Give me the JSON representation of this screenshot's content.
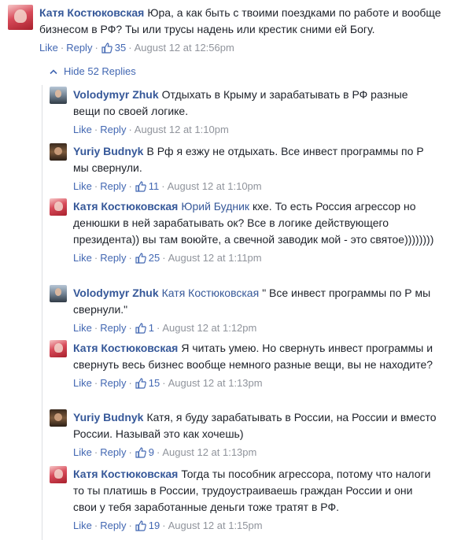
{
  "comments": [
    {
      "author": "Катя Костюковская",
      "mention": "",
      "text": "Юра, а как быть с твоими поездками по работе и вообще бизнесом в РФ? Ты или трусы надень или крестик сними ей Богу.",
      "like_label": "Like",
      "reply_label": "Reply",
      "likes": "35",
      "time": "August 12 at 12:56pm",
      "avatar": "katya"
    }
  ],
  "hide_replies_label": "Hide 52 Replies",
  "replies": [
    {
      "author": "Volodymyr Zhuk",
      "mention": "",
      "text": "Отдыхать в Крыму и зарабатывать в РФ разные вещи по своей логике.",
      "like_label": "Like",
      "reply_label": "Reply",
      "likes": "",
      "time": "August 12 at 1:10pm",
      "avatar": "volodymyr"
    },
    {
      "author": "Yuriy Budnyk",
      "mention": "",
      "text": "В Рф я езжу не отдыхать. Все инвест программы по Р мы свернули.",
      "like_label": "Like",
      "reply_label": "Reply",
      "likes": "11",
      "time": "August 12 at 1:10pm",
      "avatar": "yuriy"
    },
    {
      "author": "Катя Костюковская",
      "mention": "Юрий Будник",
      "text": "кхе. То есть Россия агрессор но денюшки в ней зарабатывать ок? Все в логике действующего президента)) вы там воюйте, а свечной заводик мой - это святое))))))))",
      "like_label": "Like",
      "reply_label": "Reply",
      "likes": "25",
      "time": "August 12 at 1:11pm",
      "avatar": "katya"
    },
    {
      "author": "Volodymyr Zhuk",
      "mention": "Катя Костюковская",
      "text": "\" Все инвест программы по Р мы свернули.\"",
      "like_label": "Like",
      "reply_label": "Reply",
      "likes": "1",
      "time": "August 12 at 1:12pm",
      "avatar": "volodymyr"
    },
    {
      "author": "Катя Костюковская",
      "mention": "",
      "text": "Я читать умею. Но свернуть инвест программы и свернуть весь бизнес вообще немного разные вещи, вы не находите?",
      "like_label": "Like",
      "reply_label": "Reply",
      "likes": "15",
      "time": "August 12 at 1:13pm",
      "avatar": "katya"
    },
    {
      "author": "Yuriy Budnyk",
      "mention": "",
      "text": "Катя, я буду зарабатывать в России, на России и вместо России. Называй это как хочешь)",
      "like_label": "Like",
      "reply_label": "Reply",
      "likes": "9",
      "time": "August 12 at 1:13pm",
      "avatar": "yuriy"
    },
    {
      "author": "Катя Костюковская",
      "mention": "",
      "text": "Тогда ты пособник агрессора, потому что налоги то ты платишь в России, трудоустраиваешь граждан России и они свои у тебя заработанные деньги тоже тратят в РФ.",
      "like_label": "Like",
      "reply_label": "Reply",
      "likes": "19",
      "time": "August 12 at 1:15pm",
      "avatar": "katya"
    }
  ],
  "colors": {
    "link": "#4267b2",
    "author": "#365899",
    "meta": "#90949c",
    "text": "#1d2129"
  }
}
